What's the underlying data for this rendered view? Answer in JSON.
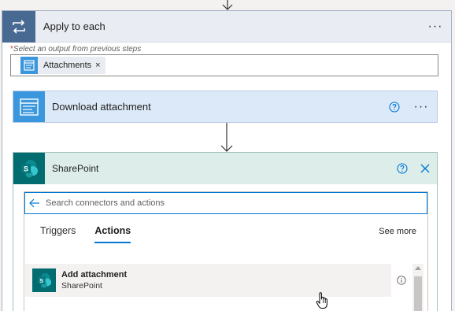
{
  "apply_to_each": {
    "title": "Apply to each",
    "more_label": "···",
    "required_mark": "*",
    "select_label": "Select an output from previous steps",
    "token": {
      "label": "Attachments",
      "remove": "×"
    }
  },
  "download_step": {
    "title": "Download attachment",
    "more_label": "···"
  },
  "sharepoint_step": {
    "title": "SharePoint",
    "icon_letter": "S",
    "search": {
      "placeholder": "Search connectors and actions",
      "value": ""
    },
    "tabs": [
      {
        "label": "Triggers",
        "active": false
      },
      {
        "label": "Actions",
        "active": true
      }
    ],
    "see_more": "See more",
    "results": [
      {
        "title": "Add attachment",
        "subtitle": "SharePoint"
      }
    ]
  },
  "colors": {
    "flow_blue": "#486991",
    "connector_blue": "#3a96dd",
    "sharepoint_teal": "#036c70",
    "accent": "#0078d4"
  }
}
